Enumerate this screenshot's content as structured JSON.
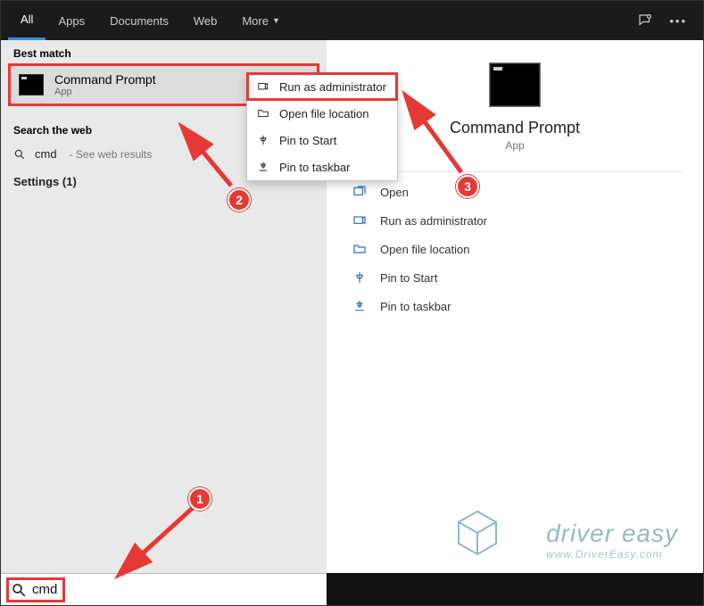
{
  "topbar": {
    "tabs": [
      "All",
      "Apps",
      "Documents",
      "Web",
      "More"
    ],
    "active_index": 0
  },
  "left": {
    "best_match_label": "Best match",
    "best_match": {
      "title": "Command Prompt",
      "subtitle": "App"
    },
    "search_web_label": "Search the web",
    "web_result": {
      "term": "cmd",
      "hint": " - See web results"
    },
    "settings_label": "Settings (1)"
  },
  "context_menu": {
    "items": [
      {
        "icon": "run-admin-icon",
        "label": "Run as administrator"
      },
      {
        "icon": "folder-open-icon",
        "label": "Open file location"
      },
      {
        "icon": "pin-start-icon",
        "label": "Pin to Start"
      },
      {
        "icon": "pin-taskbar-icon",
        "label": "Pin to taskbar"
      }
    ]
  },
  "preview": {
    "title": "Command Prompt",
    "subtitle": "App",
    "actions": [
      {
        "icon": "open-icon",
        "label": "Open"
      },
      {
        "icon": "run-admin-icon",
        "label": "Run as administrator"
      },
      {
        "icon": "folder-open-icon",
        "label": "Open file location"
      },
      {
        "icon": "pin-start-icon",
        "label": "Pin to Start"
      },
      {
        "icon": "pin-taskbar-icon",
        "label": "Pin to taskbar"
      }
    ]
  },
  "search": {
    "value": "cmd"
  },
  "annotations": {
    "badges": [
      "1",
      "2",
      "3"
    ]
  },
  "watermark": {
    "line1": "driver easy",
    "line2": "www.DriverEasy.com"
  }
}
